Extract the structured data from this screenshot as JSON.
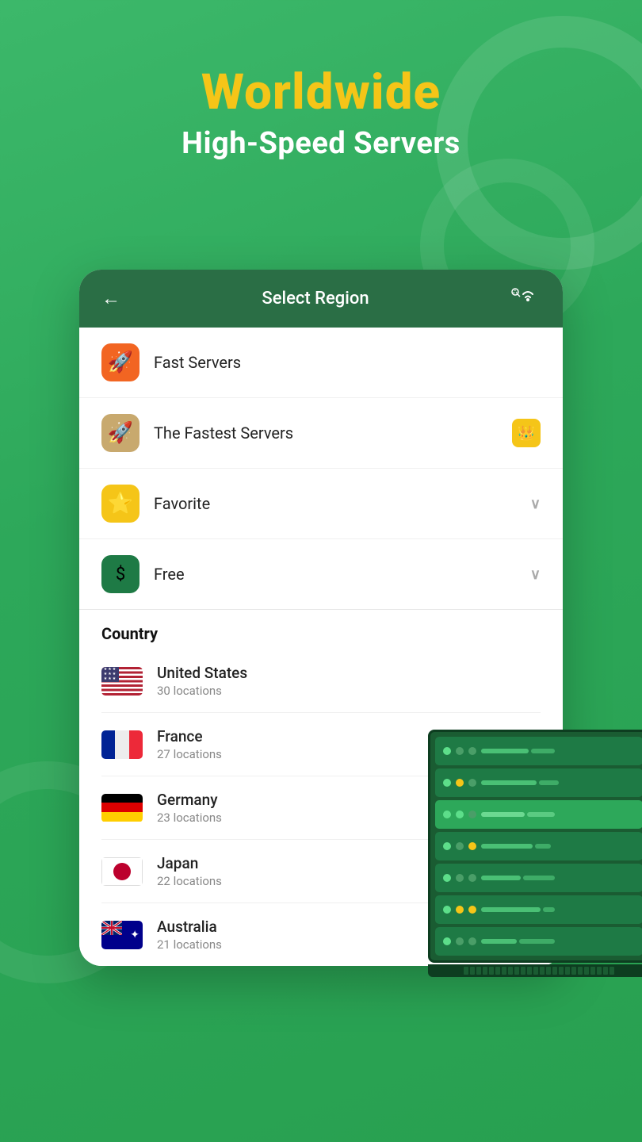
{
  "page": {
    "background_color": "#3cb86a"
  },
  "header": {
    "title_line1": "Worldwide",
    "title_line2": "High-Speed Servers"
  },
  "card": {
    "header": {
      "back_label": "←",
      "title": "Select Region",
      "search_icon": "wifi-search"
    },
    "menu_items": [
      {
        "id": "fast-servers",
        "label": "Fast Servers",
        "icon_type": "orange",
        "icon_emoji": "🚀",
        "has_crown": false,
        "has_chevron": false
      },
      {
        "id": "fastest-servers",
        "label": "The Fastest Servers",
        "icon_type": "tan",
        "icon_emoji": "🚀",
        "has_crown": true,
        "has_chevron": false
      },
      {
        "id": "favorite",
        "label": "Favorite",
        "icon_type": "yellow",
        "icon_emoji": "⭐",
        "has_crown": false,
        "has_chevron": true
      },
      {
        "id": "free",
        "label": "Free",
        "icon_type": "green-dark",
        "icon_emoji": "💲",
        "has_crown": false,
        "has_chevron": true
      }
    ],
    "country_section": {
      "heading": "Country",
      "countries": [
        {
          "id": "us",
          "name": "United States",
          "locations": "30 locations",
          "flag": "us"
        },
        {
          "id": "fr",
          "name": "France",
          "locations": "27 locations",
          "flag": "fr"
        },
        {
          "id": "de",
          "name": "Germany",
          "locations": "23 locations",
          "flag": "de"
        },
        {
          "id": "jp",
          "name": "Japan",
          "locations": "22 locations",
          "flag": "jp"
        },
        {
          "id": "au",
          "name": "Australia",
          "locations": "21 locations",
          "flag": "au"
        }
      ]
    }
  },
  "labels": {
    "crown": "👑",
    "chevron": "∨",
    "back": "←"
  }
}
